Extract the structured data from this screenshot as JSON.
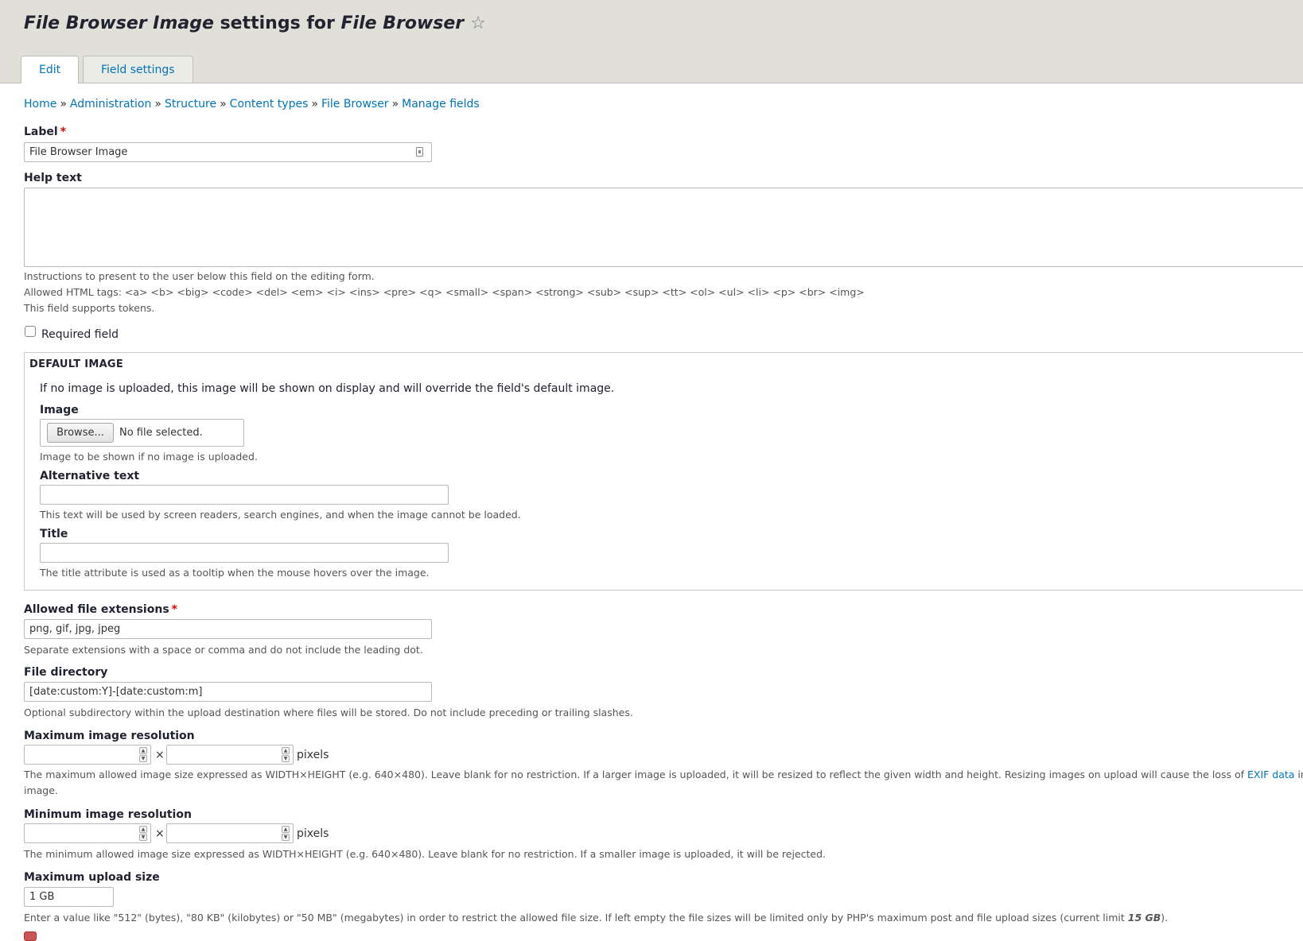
{
  "header": {
    "title_field": "File Browser Image",
    "title_middle": " settings for ",
    "title_type": "File Browser",
    "star_icon": "star-outline-icon"
  },
  "tabs": [
    {
      "label": "Edit",
      "active": true
    },
    {
      "label": "Field settings",
      "active": false
    }
  ],
  "breadcrumb": [
    "Home",
    "Administration",
    "Structure",
    "Content types",
    "File Browser",
    "Manage fields"
  ],
  "breadcrumb_separator": "»",
  "form": {
    "label": {
      "title": "Label",
      "required_mark": "*",
      "value": "File Browser Image"
    },
    "help_text": {
      "title": "Help text",
      "value": "",
      "desc1": "Instructions to present to the user below this field on the editing form.",
      "desc2": "Allowed HTML tags: <a> <b> <big> <code> <del> <em> <i> <ins> <pre> <q> <small> <span> <strong> <sub> <sup> <tt> <ol> <ul> <li> <p> <br> <img>",
      "desc3": "This field supports tokens."
    },
    "required_field": {
      "label": "Required field",
      "checked": false
    },
    "default_image": {
      "legend": "DEFAULT IMAGE",
      "intro": "If no image is uploaded, this image will be shown on display and will override the field's default image.",
      "image_label": "Image",
      "browse_button": "Browse...",
      "file_status": "No file selected.",
      "image_desc": "Image to be shown if no image is uploaded.",
      "alt_label": "Alternative text",
      "alt_value": "",
      "alt_desc": "This text will be used by screen readers, search engines, and when the image cannot be loaded.",
      "title_label": "Title",
      "title_value": "",
      "title_desc": "The title attribute is used as a tooltip when the mouse hovers over the image."
    },
    "extensions": {
      "title": "Allowed file extensions",
      "required_mark": "*",
      "value": "png, gif, jpg, jpeg",
      "desc": "Separate extensions with a space or comma and do not include the leading dot."
    },
    "directory": {
      "title": "File directory",
      "value": "[date:custom:Y]-[date:custom:m]",
      "desc": "Optional subdirectory within the upload destination where files will be stored. Do not include preceding or trailing slashes."
    },
    "max_resolution": {
      "title": "Maximum image resolution",
      "width": "",
      "height": "",
      "times": "×",
      "unit": "pixels",
      "desc_pre": "The maximum allowed image size expressed as WIDTH×HEIGHT (e.g. 640×480). Leave blank for no restriction. If a larger image is uploaded, it will be resized to reflect the given width and height. Resizing images on upload will cause the loss of ",
      "desc_link": "EXIF data",
      "desc_post": " in the",
      "desc_line2": "image."
    },
    "min_resolution": {
      "title": "Minimum image resolution",
      "width": "",
      "height": "",
      "times": "×",
      "unit": "pixels",
      "desc": "The minimum allowed image size expressed as WIDTH×HEIGHT (e.g. 640×480). Leave blank for no restriction. If a smaller image is uploaded, it will be rejected."
    },
    "upload_size": {
      "title": "Maximum upload size",
      "value": "1 GB",
      "desc_pre": "Enter a value like \"512\" (bytes), \"80 KB\" (kilobytes) or \"50 MB\" (megabytes) in order to restrict the allowed file size. If left empty the file sizes will be limited only by PHP's maximum post and file upload sizes (current limit ",
      "desc_limit": "15 GB",
      "desc_post": ")."
    }
  },
  "colors": {
    "link": "#0074bd",
    "required": "#e20000",
    "header_bg": "#e0e0d8"
  }
}
